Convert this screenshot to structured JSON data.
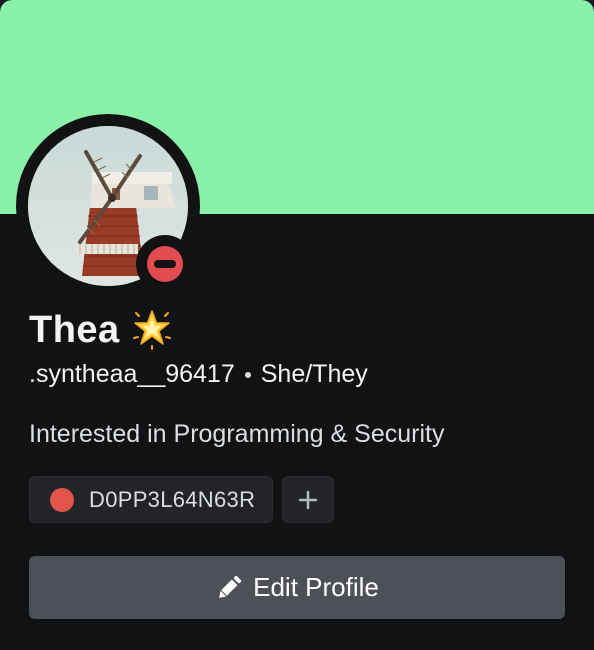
{
  "profile": {
    "display_name": "Thea",
    "username": ".syntheaa__96417",
    "pronouns": "She/They",
    "bio": "Interested in Programming & Security",
    "status": "do-not-disturb",
    "banner_color": "#89f0a8"
  },
  "roles": [
    {
      "label": "D0PP3L64N63R",
      "color": "#e0544a"
    }
  ],
  "actions": {
    "edit_profile_label": "Edit Profile"
  },
  "icons": {
    "name_emoji": "glowing-star-icon",
    "edit": "pencil-icon",
    "add_role": "plus-icon",
    "status": "do-not-disturb-icon"
  }
}
